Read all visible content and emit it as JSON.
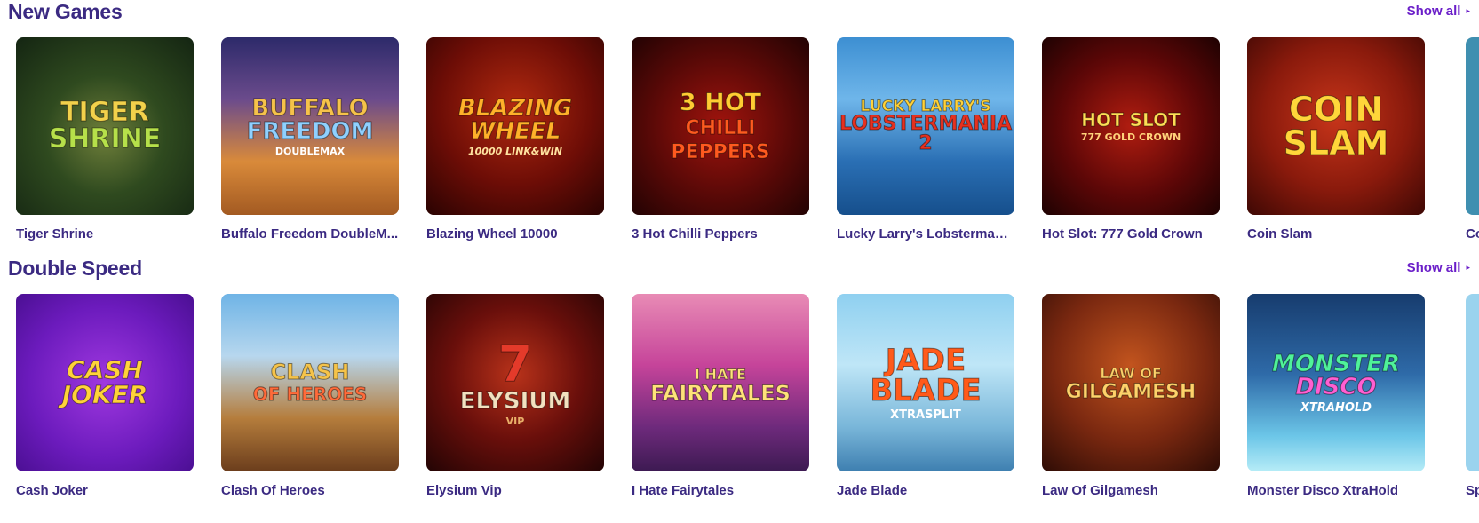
{
  "sections": [
    {
      "heading": "New Games",
      "show_all": "Show all",
      "games": [
        {
          "title": "Tiger Shrine",
          "logo": "Tiger",
          "logo2": "Shrine"
        },
        {
          "title": "Buffalo Freedom DoubleM...",
          "logo": "Buffalo",
          "logo2": "Freedom",
          "logo_sub": "DoubleMax"
        },
        {
          "title": "Blazing Wheel 10000",
          "logo": "Blazing",
          "logo2": "Wheel",
          "logo_sub": "10000 Link&Win"
        },
        {
          "title": "3 Hot Chilli Peppers",
          "logo": "3 Hot",
          "logo2": "Chilli Peppers"
        },
        {
          "title": "Lucky Larry's Lobstermani...",
          "logo": "Lucky Larry's",
          "logo2": "Lobstermania 2"
        },
        {
          "title": "Hot Slot: 777 Gold Crown",
          "logo": "Hot Slot",
          "logo_sub": "777 Gold Crown"
        },
        {
          "title": "Coin Slam",
          "logo": "Coin",
          "logo2": "Slam"
        }
      ],
      "partial_title": "Co"
    },
    {
      "heading": "Double Speed",
      "show_all": "Show all",
      "games": [
        {
          "title": "Cash Joker",
          "logo": "Cash",
          "logo2": "Joker"
        },
        {
          "title": "Clash Of Heroes",
          "logo": "Clash",
          "logo2": "Of Heroes"
        },
        {
          "title": "Elysium Vip",
          "logo": "Elysium",
          "logo_sub": "VIP"
        },
        {
          "title": "I Hate Fairytales",
          "logo": "I Hate",
          "logo2": "Fairytales"
        },
        {
          "title": "Jade Blade",
          "logo": "Jade",
          "logo2": "Blade",
          "logo_sub": "XtraSplit"
        },
        {
          "title": "Law Of Gilgamesh",
          "logo": "Law of",
          "logo2": "Gilgamesh"
        },
        {
          "title": "Monster Disco XtraHold",
          "logo": "Monster",
          "logo2": "Disco",
          "logo_sub": "XtraHold"
        }
      ],
      "partial_title": "Sp"
    }
  ],
  "icons": {
    "show_all_arrow": "caret-right-icon"
  }
}
